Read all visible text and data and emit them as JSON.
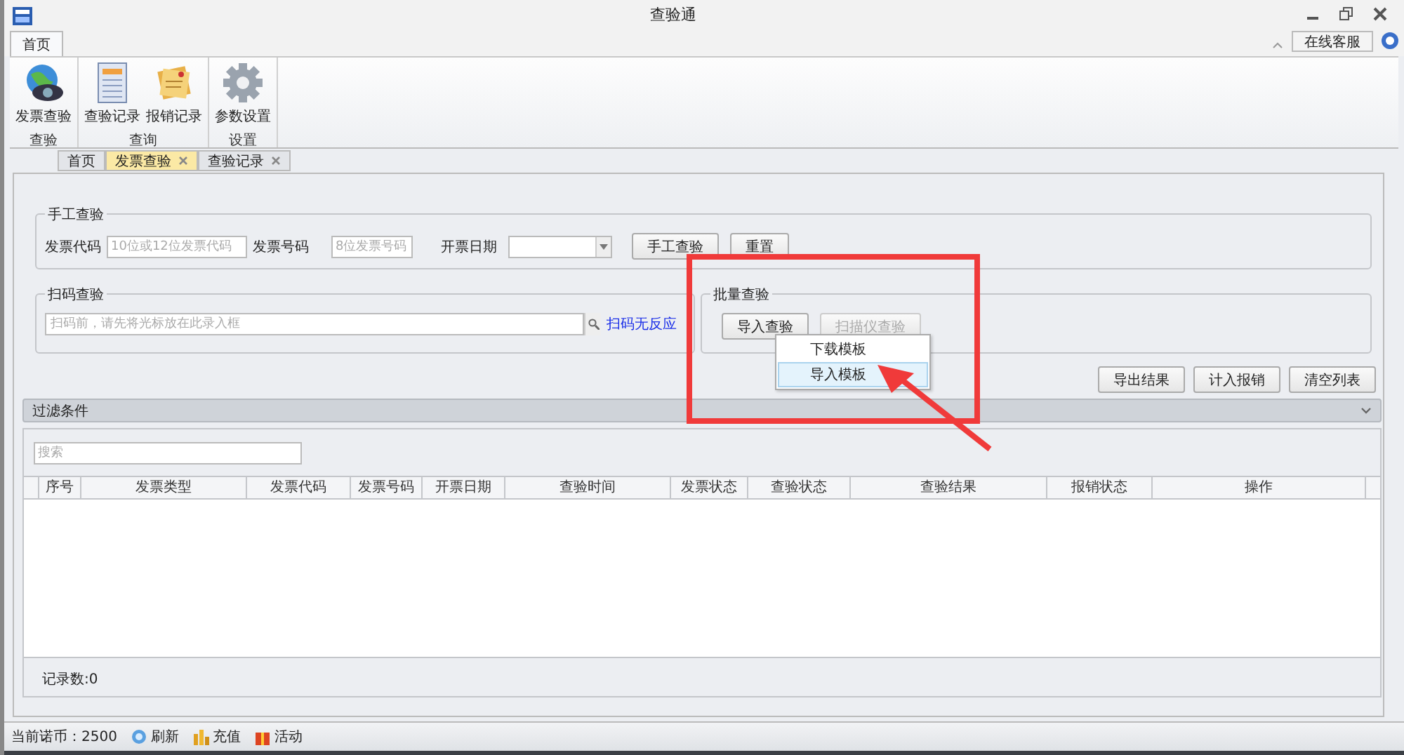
{
  "window": {
    "title": "查验通"
  },
  "ribbon": {
    "tabs": [
      {
        "label": "首页",
        "selected": true
      }
    ],
    "support_button": "在线客服",
    "groups": [
      {
        "label": "查验",
        "items": [
          {
            "label": "发票查验",
            "kind": "globe"
          }
        ]
      },
      {
        "label": "查询",
        "items": [
          {
            "label": "查验记录",
            "kind": "document"
          },
          {
            "label": "报销记录",
            "kind": "notes"
          }
        ]
      },
      {
        "label": "设置",
        "items": [
          {
            "label": "参数设置",
            "kind": "gear"
          }
        ]
      }
    ]
  },
  "doc_tabs": [
    {
      "label": "首页",
      "selected": false,
      "closable": false
    },
    {
      "label": "发票查验",
      "selected": true,
      "closable": true
    },
    {
      "label": "查验记录",
      "selected": false,
      "closable": true
    }
  ],
  "manual": {
    "title": "手工查验",
    "code_label": "发票代码",
    "code_placeholder": "10位或12位发票代码",
    "number_label": "发票号码",
    "number_placeholder": "8位发票号码",
    "date_label": "开票日期",
    "buttons": [
      {
        "label": "手工查验"
      },
      {
        "label": "重置"
      }
    ]
  },
  "scan": {
    "title": "扫码查验",
    "placeholder": "扫码前，请先将光标放在此录入框",
    "link": "扫码无反应"
  },
  "batch": {
    "title": "批量查验",
    "buttons": [
      {
        "label": "导入查验",
        "disabled": false
      },
      {
        "label": "扫描仪查验",
        "disabled": true
      }
    ]
  },
  "menu": {
    "items": [
      {
        "label": "下载模板",
        "selected": false
      },
      {
        "label": "导入模板",
        "selected": true
      }
    ]
  },
  "actions": [
    {
      "label": "导出结果"
    },
    {
      "label": "计入报销"
    },
    {
      "label": "清空列表"
    }
  ],
  "filter": {
    "title": "过滤条件",
    "expanded": false
  },
  "search": {
    "placeholder": "搜索"
  },
  "table": {
    "columns": [
      "序号",
      "发票类型",
      "发票代码",
      "发票号码",
      "开票日期",
      "查验时间",
      "发票状态",
      "查验状态",
      "查验结果",
      "报销状态",
      "操作"
    ]
  },
  "record_count": "记录数:0",
  "status_bar": {
    "balance": "当前诺币：2500",
    "items": [
      {
        "label": "刷新",
        "kind": "refresh"
      },
      {
        "label": "充值",
        "kind": "coins"
      },
      {
        "label": "活动",
        "kind": "gift"
      }
    ]
  }
}
